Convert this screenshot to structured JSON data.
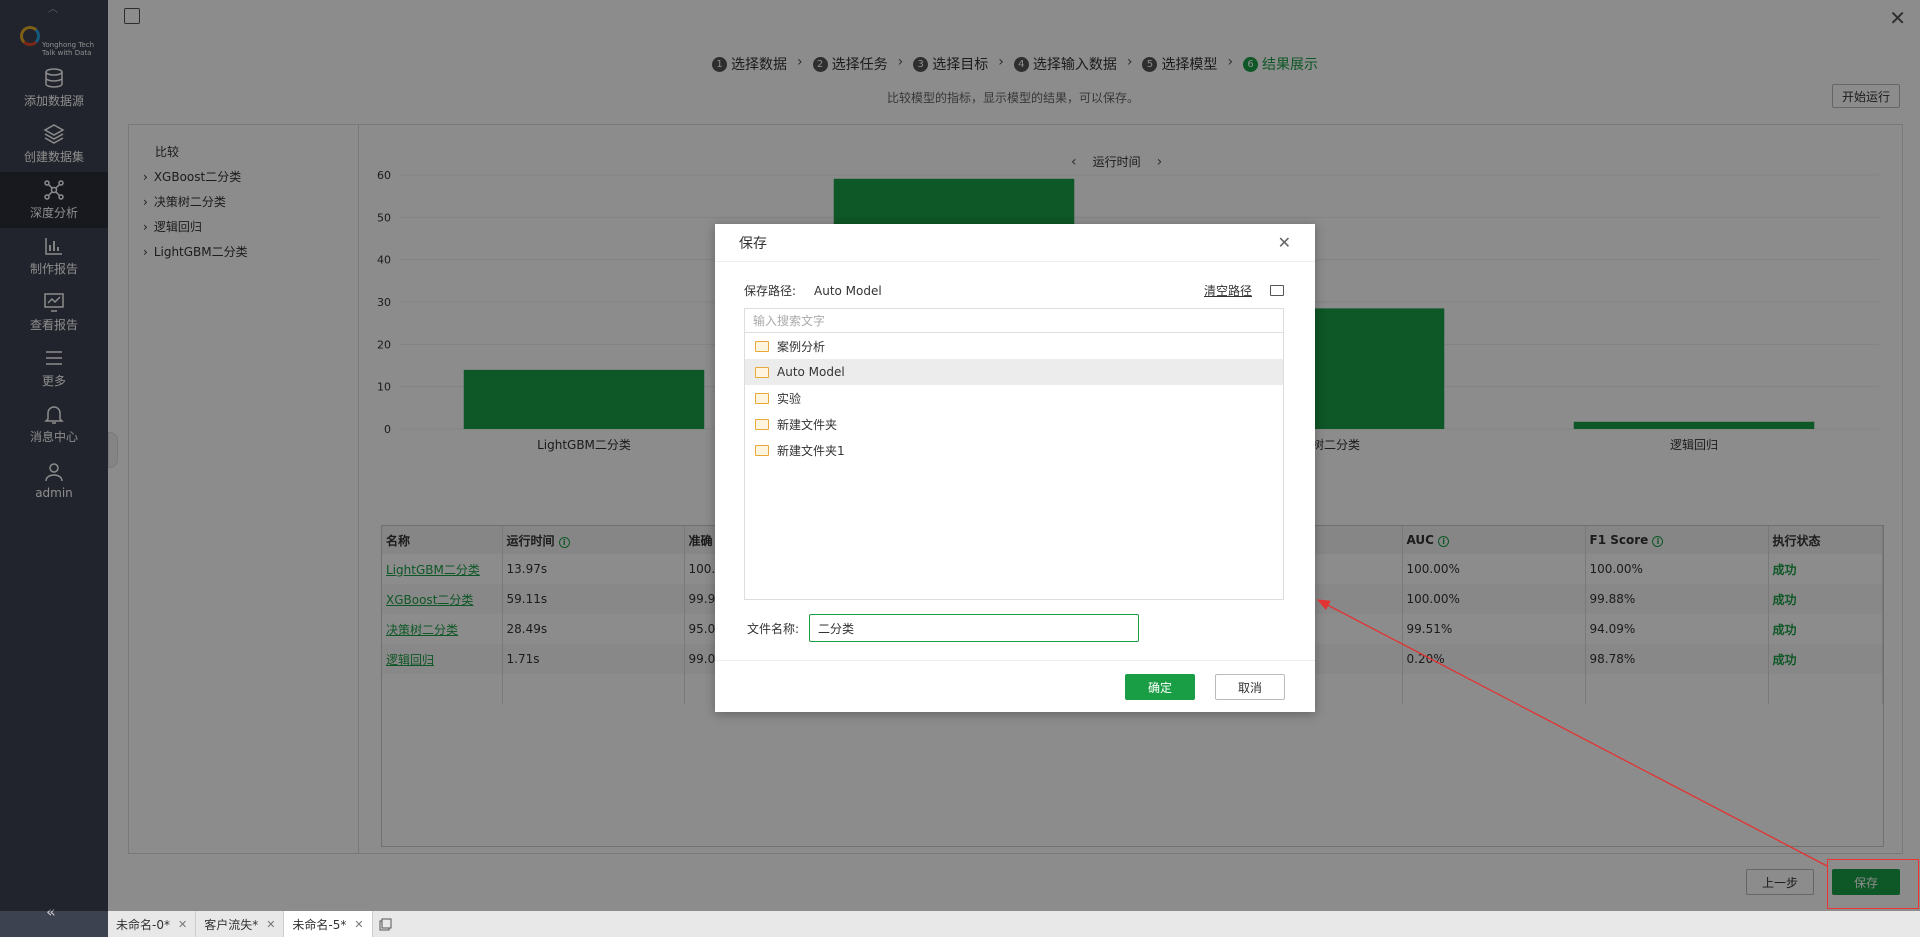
{
  "sidebar": {
    "brand_line1": "Yonghong Tech",
    "brand_line2": "Talk with Data",
    "items": [
      {
        "label": "添加数据源",
        "icon": "database-icon"
      },
      {
        "label": "创建数据集",
        "icon": "layers-icon"
      },
      {
        "label": "深度分析",
        "icon": "network-icon"
      },
      {
        "label": "制作报告",
        "icon": "chart-icon"
      },
      {
        "label": "查看报告",
        "icon": "monitor-icon"
      },
      {
        "label": "更多",
        "icon": "menu-icon"
      },
      {
        "label": "消息中心",
        "icon": "bell-icon"
      },
      {
        "label": "admin",
        "icon": "user-icon"
      }
    ],
    "collapse": "«"
  },
  "steps": [
    {
      "num": "1",
      "label": "选择数据"
    },
    {
      "num": "2",
      "label": "选择任务"
    },
    {
      "num": "3",
      "label": "选择目标"
    },
    {
      "num": "4",
      "label": "选择输入数据"
    },
    {
      "num": "5",
      "label": "选择模型"
    },
    {
      "num": "6",
      "label": "结果展示"
    }
  ],
  "subtitle": "比较模型的指标，显示模型的结果，可以保存。",
  "run_button": "开始运行",
  "tree": {
    "head": "比较",
    "items": [
      "XGBoost二分类",
      "决策树二分类",
      "逻辑回归",
      "LightGBM二分类"
    ]
  },
  "chart_nav": {
    "prev": "‹",
    "label": "运行时间",
    "next": "›"
  },
  "chart_data": {
    "type": "bar",
    "categories": [
      "LightGBM二分类",
      "XGBoost二分类",
      "决策树二分类",
      "逻辑回归"
    ],
    "values": [
      13.97,
      59.11,
      28.49,
      1.71
    ],
    "ylim": [
      0,
      60
    ],
    "yticks": [
      "0",
      "10",
      "20",
      "30",
      "40",
      "50",
      "60"
    ],
    "visible_labels": [
      "LightGBM二分类",
      "",
      "决策树二分类",
      "逻辑回归"
    ],
    "color": "#1a9e45"
  },
  "table": {
    "headers": [
      "名称",
      "运行时间",
      "准确",
      "AUC",
      "F1 Score",
      "执行状态"
    ],
    "rows": [
      {
        "name": "LightGBM二分类",
        "time": "13.97s",
        "acc": "100.0",
        "auc": "100.00%",
        "f1": "100.00%",
        "status": "成功"
      },
      {
        "name": "XGBoost二分类",
        "time": "59.11s",
        "acc": "99.91",
        "auc": "100.00%",
        "f1": "99.88%",
        "status": "成功"
      },
      {
        "name": "决策树二分类",
        "time": "28.49s",
        "acc": "95.01",
        "auc": "99.51%",
        "f1": "94.09%",
        "status": "成功"
      },
      {
        "name": "逻辑回归",
        "time": "1.71s",
        "acc": "99.06",
        "auc": "0.20%",
        "f1": "98.78%",
        "status": "成功"
      }
    ]
  },
  "buttons": {
    "prev": "上一步",
    "save": "保存"
  },
  "tabs": [
    "未命名-0*",
    "客户流失*",
    "未命名-5*"
  ],
  "dialog": {
    "title": "保存",
    "path_label": "保存路径:",
    "path_value": "Auto Model",
    "clear_path": "清空路径",
    "search_placeholder": "输入搜索文字",
    "folders": [
      "案例分析",
      "Auto Model",
      "实验",
      "新建文件夹",
      "新建文件夹1"
    ],
    "selected_folder": "Auto Model",
    "file_name_label": "文件名称:",
    "file_name_value": "二分类",
    "ok": "确定",
    "cancel": "取消"
  },
  "colors": {
    "accent": "#1a9e45",
    "sidebar": "#3c4250",
    "annotation": "#e33333"
  }
}
